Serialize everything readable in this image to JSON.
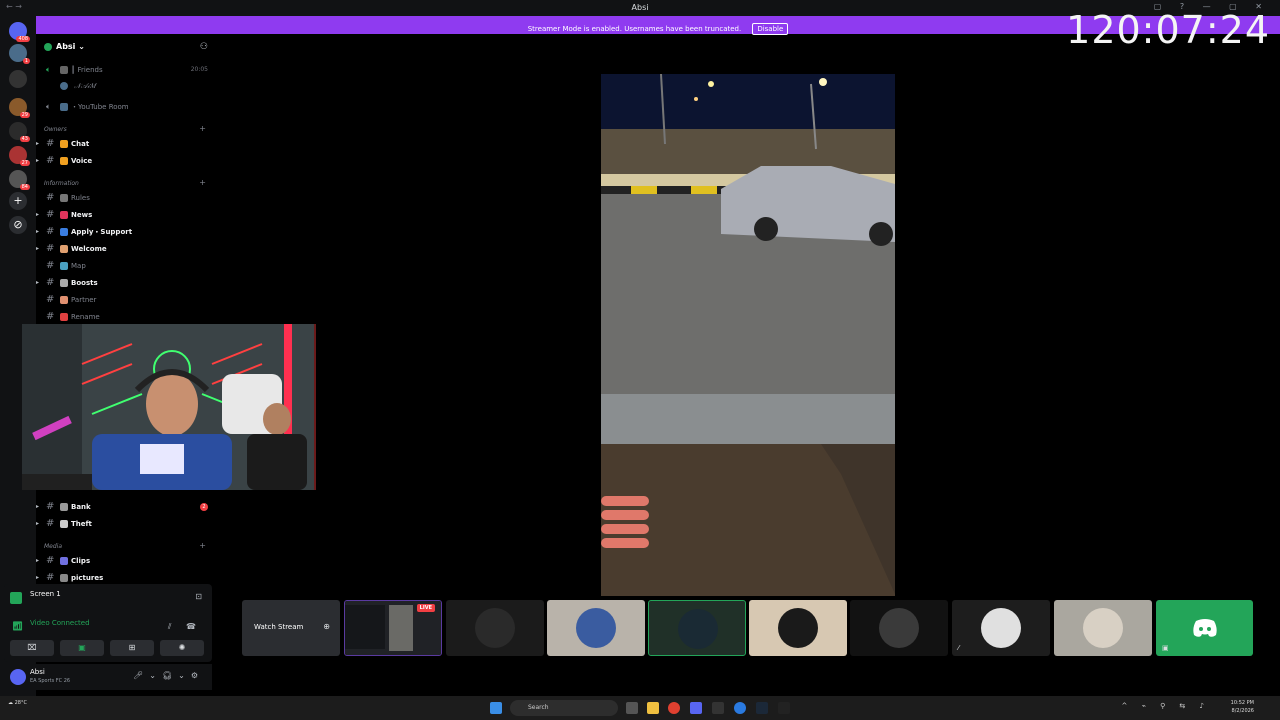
{
  "window": {
    "title": "Absi",
    "nav": "← →",
    "controls": "▢ ? — ▢ ✕"
  },
  "overlay_clock": "120:07:24",
  "banner": {
    "message": "Streamer Mode is enabled. Usernames have been truncated.",
    "button": "Disable"
  },
  "rail": {
    "badges": [
      "408",
      "1",
      "29",
      "43",
      "27",
      "84"
    ]
  },
  "server": {
    "name": "Absi ⌄"
  },
  "channels": [
    {
      "type": "voice",
      "label": "┃ Friends",
      "right": "20:05"
    },
    {
      "type": "member",
      "label": "𝒩𝒜𝒾𝑀"
    },
    {
      "type": "voice",
      "label": "・YouTube Room"
    },
    {
      "type": "category",
      "label": "Owners"
    },
    {
      "type": "text",
      "label": "Chat",
      "bold": true
    },
    {
      "type": "text",
      "label": "Voice",
      "bold": true
    },
    {
      "type": "category",
      "label": "Information"
    },
    {
      "type": "text",
      "label": "Rules",
      "bold": false
    },
    {
      "type": "text",
      "label": "News",
      "bold": true
    },
    {
      "type": "text",
      "label": "Apply・Support",
      "bold": true
    },
    {
      "type": "text",
      "label": "Welcome",
      "bold": true
    },
    {
      "type": "text",
      "label": "Map",
      "bold": false
    },
    {
      "type": "text",
      "label": "Boosts",
      "bold": true
    },
    {
      "type": "text",
      "label": "Partner",
      "bold": false
    },
    {
      "type": "text",
      "label": "Rename",
      "bold": false
    },
    {
      "type": "text",
      "label": "Bank",
      "bold": true,
      "badge": "2"
    },
    {
      "type": "text",
      "label": "Theft",
      "bold": true
    },
    {
      "type": "category",
      "label": "Media"
    },
    {
      "type": "text",
      "label": "Clips",
      "bold": true
    },
    {
      "type": "text",
      "label": "pictures",
      "bold": true
    }
  ],
  "screen_share": {
    "title": "Screen 1"
  },
  "voice": {
    "status": "Video Connected"
  },
  "user": {
    "name": "Absi",
    "status": "EA Sports FC 26"
  },
  "tiles": {
    "watch_label": "Watch Stream",
    "live": "LIVE"
  },
  "taskbar": {
    "weather": "28°C",
    "search": "Search",
    "time": "10:52 PM",
    "date": "8/2/2026"
  }
}
